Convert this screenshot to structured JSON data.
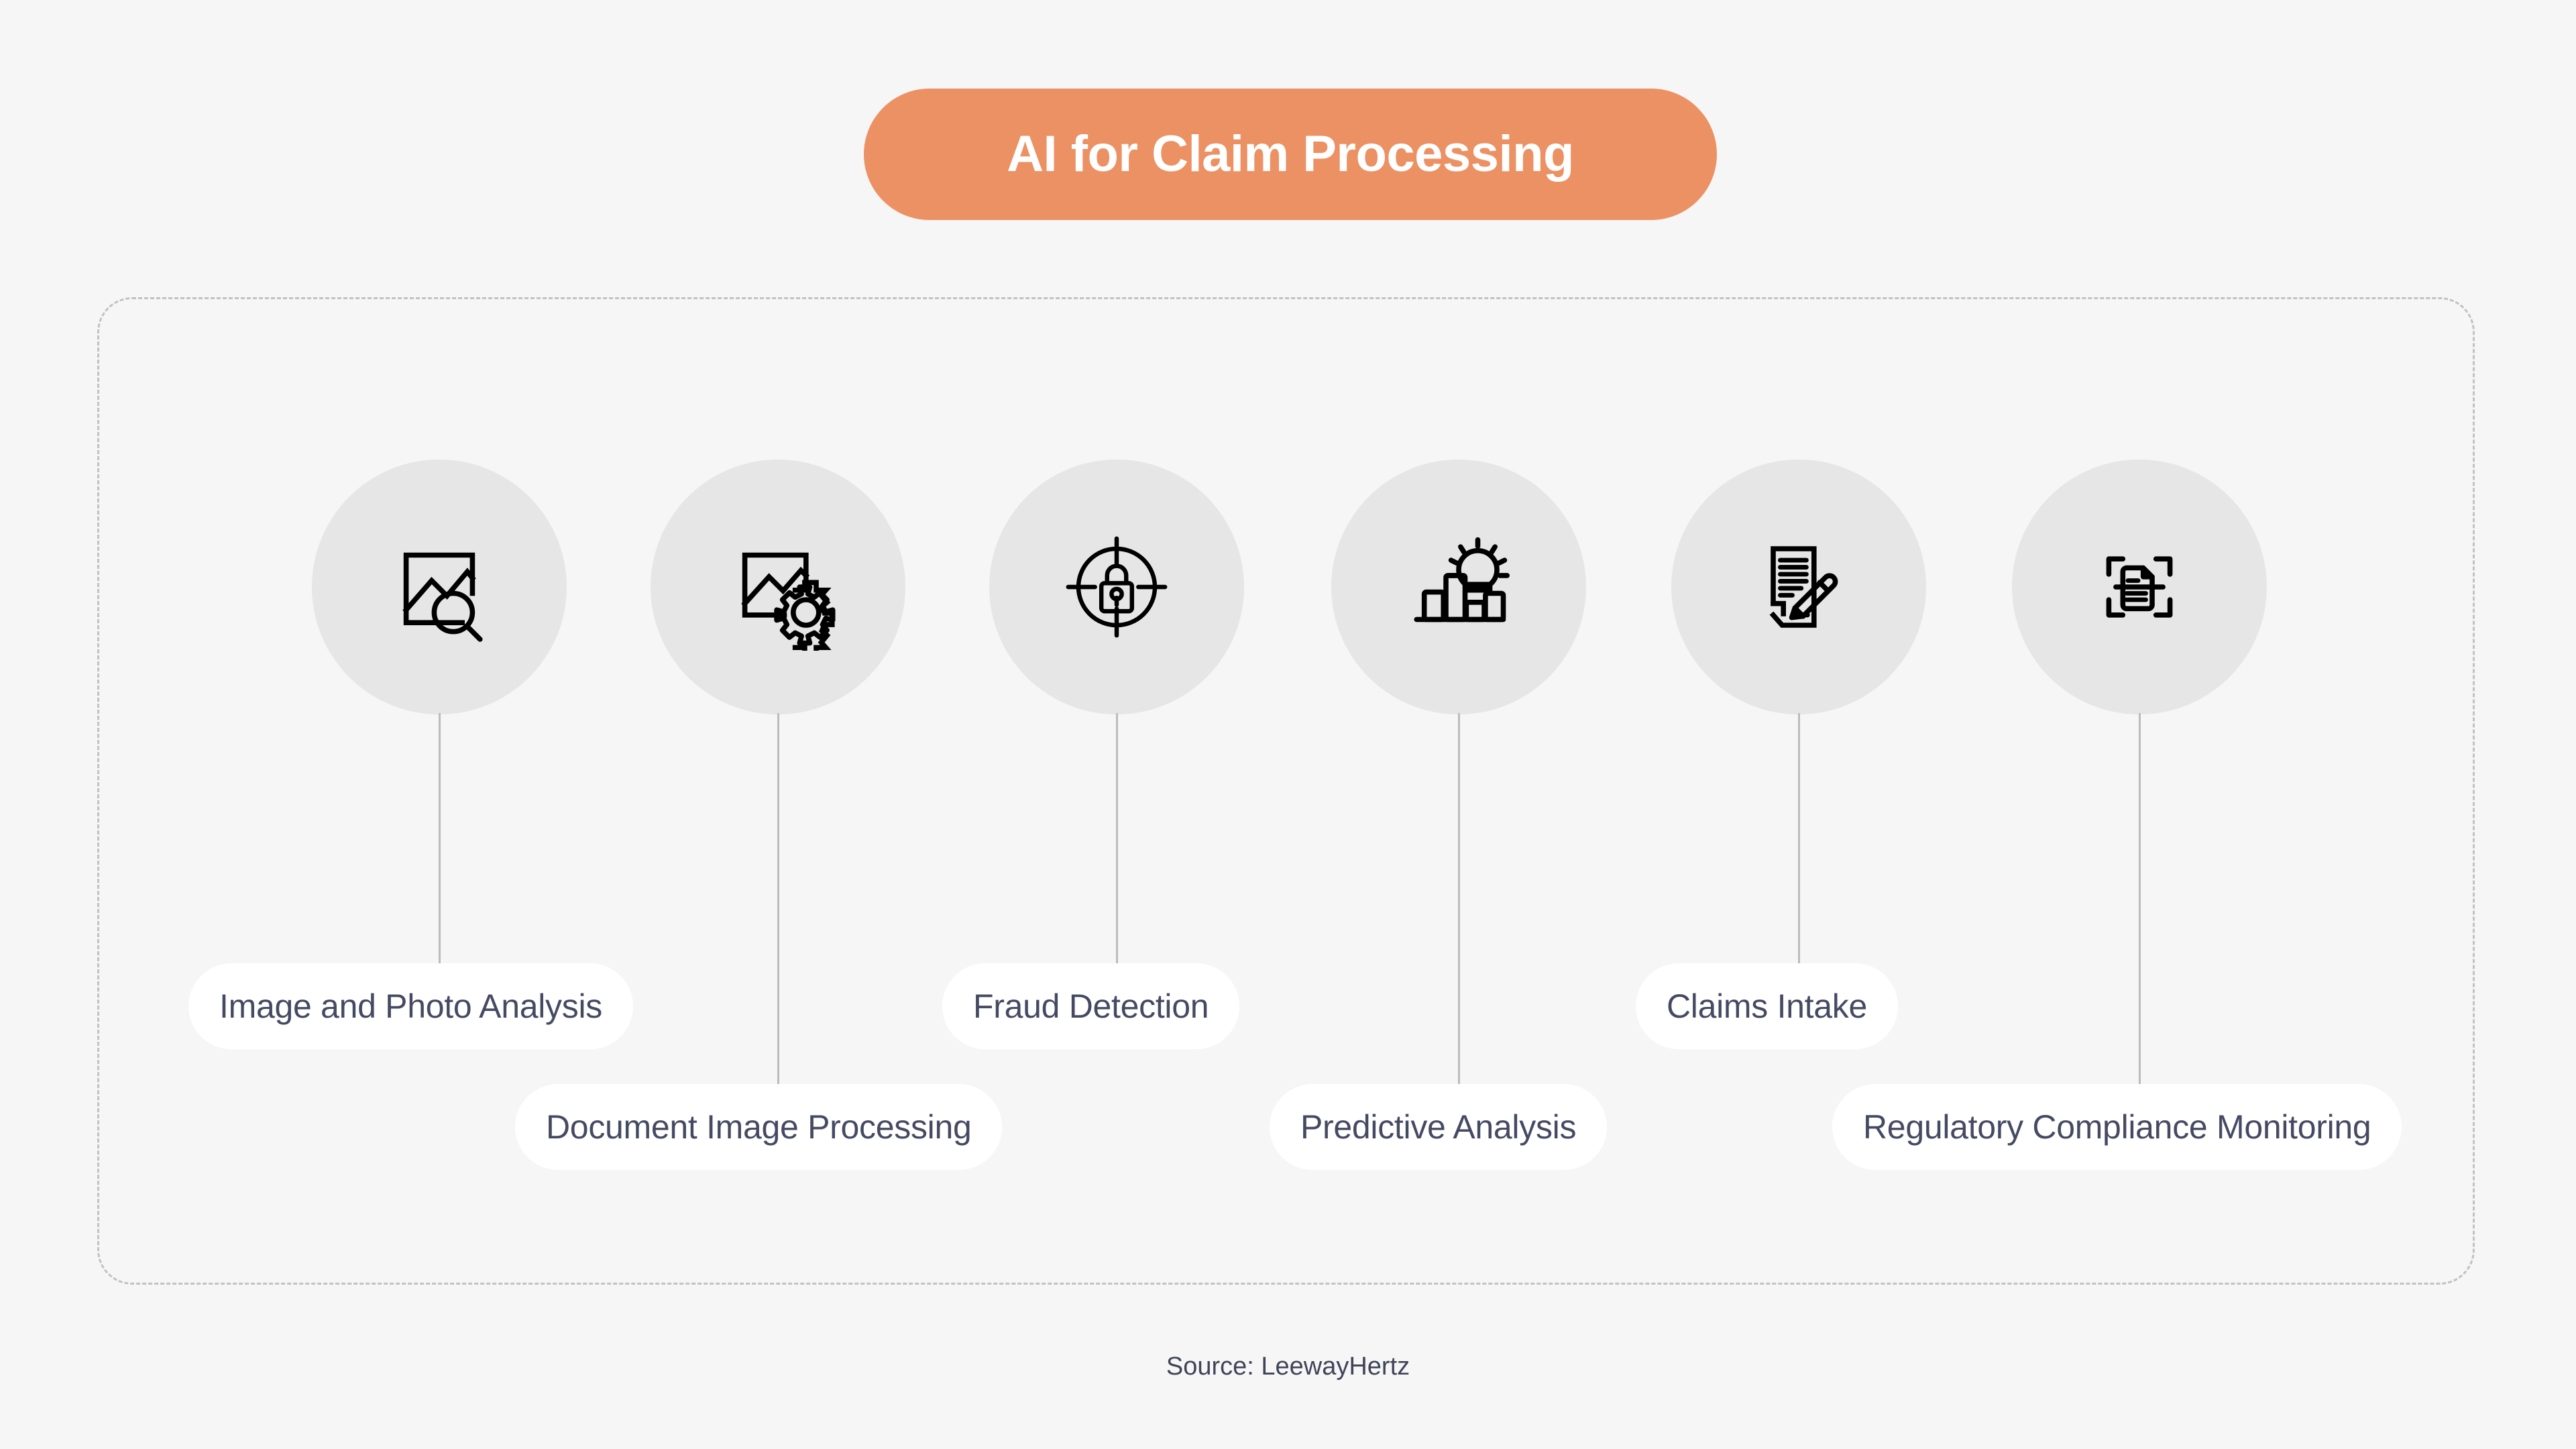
{
  "page": {
    "background_color": "#f6f6f6"
  },
  "header": {
    "title": "AI for Claim Processing",
    "pill_color": "#ec9163",
    "title_color": "#ffffff"
  },
  "frame": {
    "border_style": "dashed",
    "border_color": "#c2c2c2"
  },
  "nodes": [
    {
      "id": "image-photo-analysis",
      "label": "Image and Photo Analysis",
      "icon": "image-search-icon",
      "row": "upper",
      "circle_color": "#e6e6e6",
      "pill_color": "#ffffff",
      "label_color": "#454a63"
    },
    {
      "id": "document-image-processing",
      "label": "Document Image Processing",
      "icon": "image-gear-icon",
      "row": "lower",
      "circle_color": "#e6e6e6",
      "pill_color": "#ffffff",
      "label_color": "#454a63"
    },
    {
      "id": "fraud-detection",
      "label": "Fraud Detection",
      "icon": "target-lock-icon",
      "row": "upper",
      "circle_color": "#e6e6e6",
      "pill_color": "#ffffff",
      "label_color": "#454a63"
    },
    {
      "id": "predictive-analysis",
      "label": "Predictive Analysis",
      "icon": "bar-chart-crystal-ball-icon",
      "row": "lower",
      "circle_color": "#e6e6e6",
      "pill_color": "#ffffff",
      "label_color": "#454a63"
    },
    {
      "id": "claims-intake",
      "label": "Claims Intake",
      "icon": "document-pencil-icon",
      "row": "upper",
      "circle_color": "#e6e6e6",
      "pill_color": "#ffffff",
      "label_color": "#454a63"
    },
    {
      "id": "regulatory-compliance-monitoring",
      "label": "Regulatory Compliance Monitoring",
      "icon": "document-scan-icon",
      "row": "lower",
      "circle_color": "#e6e6e6",
      "pill_color": "#ffffff",
      "label_color": "#454a63"
    }
  ],
  "footer": {
    "source": "Source: LeewayHertz"
  }
}
